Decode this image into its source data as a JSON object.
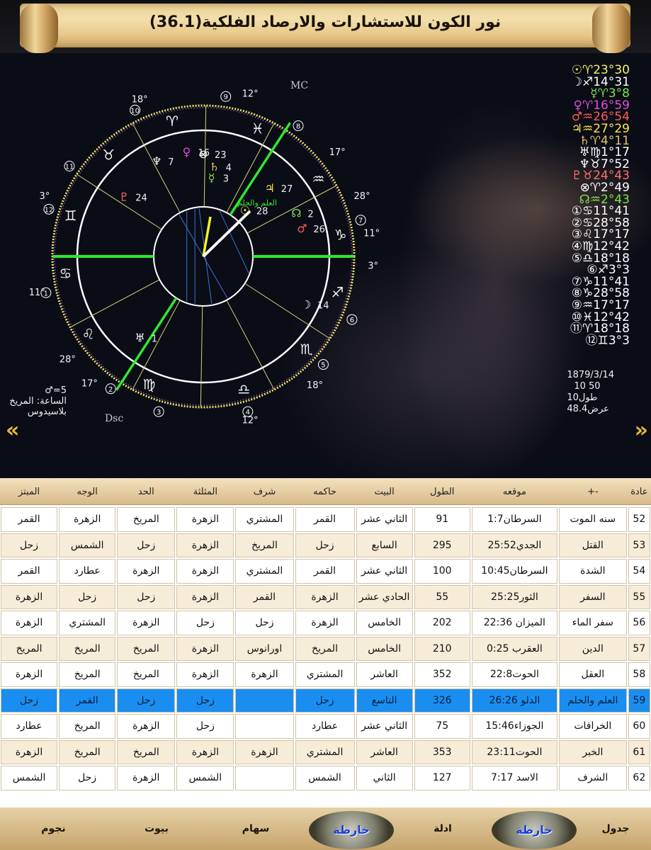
{
  "header": {
    "title": "نور الكون للاستشارات والارصاد الفلكية(36.1)"
  },
  "chart": {
    "mc_label": "MC",
    "dsc_label": "Dsc",
    "cusp_degrees": [
      "18°",
      "12°",
      "17°",
      "28°",
      "11°",
      "3°",
      "11°",
      "28°",
      "17°",
      "12°",
      "18°",
      "3°"
    ],
    "house_numbers": [
      "1",
      "2",
      "3",
      "4",
      "5",
      "6",
      "7",
      "8",
      "9",
      "10",
      "11",
      "12"
    ],
    "planet_labels": [
      "7",
      "24",
      "16",
      "23",
      "4",
      "3",
      "27",
      "2",
      "26",
      "14",
      "1",
      "28"
    ],
    "arabic_part_label": "العلم والحلم",
    "planet_list": [
      {
        "text": "☉♈23°30",
        "color": "#f5f56a"
      },
      {
        "text": "☽♐14°31",
        "color": "#ffffff"
      },
      {
        "text": "☿♈3°8",
        "color": "#7ee44a"
      },
      {
        "text": "♀♈16°59",
        "color": "#e24de0"
      },
      {
        "text": "♂♒26°54",
        "color": "#ff5b5b"
      },
      {
        "text": "♃♒27°29",
        "color": "#ffe84d"
      },
      {
        "text": "♄♈4°11",
        "color": "#e6c26a"
      },
      {
        "text": "♅♍1°17",
        "color": "#ffffff"
      },
      {
        "text": "♆♉7°52",
        "color": "#ffffff"
      },
      {
        "text": "♇♉24°43",
        "color": "#ff7070"
      },
      {
        "text": "⊗♈2°49",
        "color": "#ffffff"
      },
      {
        "text": "☊♒2°43",
        "color": "#7ee44a"
      },
      {
        "text": "①♋11°41",
        "color": "#ffffff"
      },
      {
        "text": "②♋28°58",
        "color": "#ffffff"
      },
      {
        "text": "③♌17°17",
        "color": "#ffffff"
      },
      {
        "text": "④♍12°42",
        "color": "#ffffff"
      },
      {
        "text": "⑤♎18°18",
        "color": "#ffffff"
      },
      {
        "text": "⑥♐3°3",
        "color": "#ffffff"
      },
      {
        "text": "⑦♑11°41",
        "color": "#ffffff"
      },
      {
        "text": "⑧♑28°58",
        "color": "#ffffff"
      },
      {
        "text": "⑨♒17°17",
        "color": "#ffffff"
      },
      {
        "text": "⑩♓12°42",
        "color": "#ffffff"
      },
      {
        "text": "⑪♈18°18",
        "color": "#ffffff"
      },
      {
        "text": "⑫♊3°3",
        "color": "#ffffff"
      }
    ],
    "birth_date": "1879/3/14",
    "birth_time": "10 50",
    "longitude": "طول10",
    "latitude": "عرض48.4",
    "hour_line1": "5=♂",
    "hour_line2": "الساعة: المريخ",
    "hour_line3": "بلاسيدوس"
  },
  "nav": {
    "prev": "«",
    "next": "»"
  },
  "table": {
    "headers": [
      {
        "label": "عادة",
        "w": 34
      },
      {
        "label": "+-",
        "w": 100
      },
      {
        "label": "موقعه",
        "w": 126
      },
      {
        "label": "الطول",
        "w": 83
      },
      {
        "label": "البيت",
        "w": 84
      },
      {
        "label": "حاكمه",
        "w": 88
      },
      {
        "label": "شرف",
        "w": 86
      },
      {
        "label": "المثلثة",
        "w": 85
      },
      {
        "label": "الحد",
        "w": 86
      },
      {
        "label": "الوجه",
        "w": 84
      },
      {
        "label": "المبتز",
        "w": 84
      }
    ],
    "rows": [
      {
        "n": "52",
        "name": "سنه الموت",
        "pos": "السرطان1:7",
        "len": "91",
        "house": "الثاني عشر",
        "ruler": "القمر",
        "exalt": "المشتري",
        "trip": "الزهرة",
        "term": "المريخ",
        "face": "الزهرة",
        "alm": "القمر"
      },
      {
        "n": "53",
        "name": "القتل",
        "pos": "الجدي25:52",
        "len": "295",
        "house": "السابع",
        "ruler": "زحل",
        "exalt": "المريخ",
        "trip": "الزهرة",
        "term": "زحل",
        "face": "الشمس",
        "alm": "زحل"
      },
      {
        "n": "54",
        "name": "الشدة",
        "pos": "السرطان10:45",
        "len": "100",
        "house": "الثاني عشر",
        "ruler": "القمر",
        "exalt": "المشتري",
        "trip": "الزهرة",
        "term": "الزهرة",
        "face": "عطارد",
        "alm": "القمر"
      },
      {
        "n": "55",
        "name": "السفر",
        "pos": "الثور25:25",
        "len": "55",
        "house": "الحادي عشر",
        "ruler": "الزهرة",
        "exalt": "القمر",
        "trip": "الزهرة",
        "term": "زحل",
        "face": "زحل",
        "alm": "الزهرة"
      },
      {
        "n": "56",
        "name": "سفر الماء",
        "pos": "الميزان 22:36",
        "len": "202",
        "house": "الخامس",
        "ruler": "الزهرة",
        "exalt": "زحل",
        "trip": "زحل",
        "term": "الزهرة",
        "face": "المشتري",
        "alm": "الزهرة"
      },
      {
        "n": "57",
        "name": "الدين",
        "pos": "العقرب 0:25",
        "len": "210",
        "house": "الخامس",
        "ruler": "المريخ",
        "exalt": "اورانوس",
        "trip": "الزهرة",
        "term": "المريخ",
        "face": "المريخ",
        "alm": "المريخ"
      },
      {
        "n": "58",
        "name": "العقل",
        "pos": "الحوت22:8",
        "len": "352",
        "house": "العاشر",
        "ruler": "المشتري",
        "exalt": "الزهرة",
        "trip": "الزهرة",
        "term": "المريخ",
        "face": "المريخ",
        "alm": "الزهرة"
      },
      {
        "n": "59",
        "name": "العلم والحلم",
        "pos": "الدلو 26:26",
        "len": "326",
        "house": "التاسع",
        "ruler": "زحل",
        "exalt": "",
        "trip": "زحل",
        "term": "زحل",
        "face": "القمر",
        "alm": "زحل"
      },
      {
        "n": "60",
        "name": "الخرافات",
        "pos": "الجوزاء15:46",
        "len": "75",
        "house": "الثاني عشر",
        "ruler": "عطارد",
        "exalt": "",
        "trip": "زحل",
        "term": "الزهرة",
        "face": "المريخ",
        "alm": "عطارد"
      },
      {
        "n": "61",
        "name": "الخبر",
        "pos": "الحوت23:11",
        "len": "353",
        "house": "العاشر",
        "ruler": "المشتري",
        "exalt": "الزهرة",
        "trip": "الزهرة",
        "term": "المريخ",
        "face": "المريخ",
        "alm": "الزهرة"
      },
      {
        "n": "62",
        "name": "الشرف",
        "pos": "الاسد 7:17",
        "len": "127",
        "house": "الثاني",
        "ruler": "الشمس",
        "exalt": "",
        "trip": "الشمس",
        "term": "الزهرة",
        "face": "زحل",
        "alm": "الشمس"
      }
    ],
    "selected_row": "59"
  },
  "bottom_bar": {
    "tabs": [
      {
        "label": "جدول",
        "w": 100,
        "type": "text"
      },
      {
        "label": "خارطة",
        "w": 130,
        "type": "map"
      },
      {
        "label": "ادلة",
        "w": 128,
        "type": "text"
      },
      {
        "label": "خارطة",
        "w": 130,
        "type": "map"
      },
      {
        "label": "سهام",
        "w": 140,
        "type": "text"
      },
      {
        "label": "بيوت",
        "w": 140,
        "type": "text"
      },
      {
        "label": "نجوم",
        "w": 151,
        "type": "text"
      }
    ]
  }
}
